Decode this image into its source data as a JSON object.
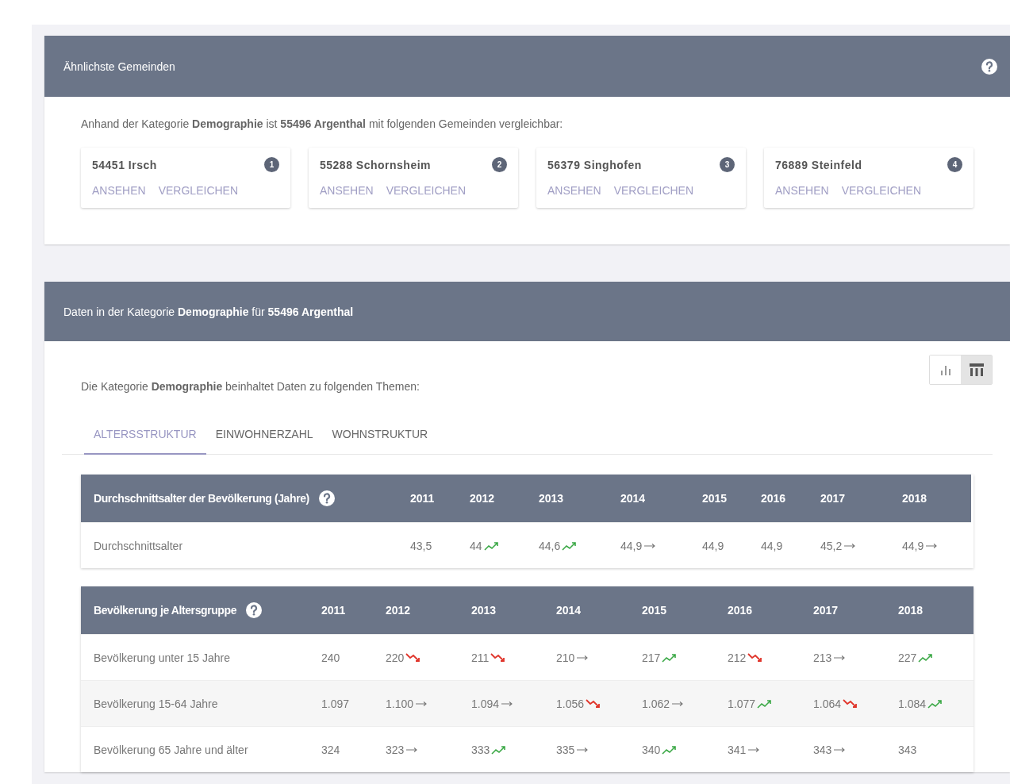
{
  "similar_panel": {
    "title": "Ähnlichste Gemeinden",
    "intro": "Anhand der Kategorie **Demographie** ist **55496 Argenthal** mit folgenden Gemeinden vergleichbar:",
    "municipalities": [
      {
        "name": "54451 Irsch",
        "rank": "1",
        "actions": [
          "ANSEHEN",
          "VERGLEICHEN"
        ]
      },
      {
        "name": "55288 Schornsheim",
        "rank": "2",
        "actions": [
          "ANSEHEN",
          "VERGLEICHEN"
        ]
      },
      {
        "name": "56379 Singhofen",
        "rank": "3",
        "actions": [
          "ANSEHEN",
          "VERGLEICHEN"
        ]
      },
      {
        "name": "76889 Steinfeld",
        "rank": "4",
        "actions": [
          "ANSEHEN",
          "VERGLEICHEN"
        ]
      }
    ]
  },
  "data_panel": {
    "title": "Daten in der Kategorie **Demographie** für **55496 Argenthal**",
    "view_toggle": [
      {
        "kind": "chart",
        "selected": false
      },
      {
        "kind": "table",
        "selected": true
      }
    ],
    "intro": "Die Kategorie **Demographie** beinhaltet Daten zu folgenden Themen:",
    "tabs": [
      {
        "label": "ALTERSSTRUKTUR",
        "selected": true
      },
      {
        "label": "EINWOHNERZAHL",
        "selected": false
      },
      {
        "label": "WOHNSTRUKTUR",
        "selected": false
      }
    ],
    "tables": [
      {
        "title": "Durchschnittsalter der Bevölkerung (Jahre)",
        "years": [
          "2011",
          "2012",
          "2013",
          "2014",
          "2015",
          "2016",
          "2017",
          "2018"
        ],
        "rows": [
          {
            "label": "Durchschnittsalter",
            "cells": [
              {
                "value": "43,5",
                "kind": "plain"
              },
              {
                "value": "44",
                "kind": "up"
              },
              {
                "value": "44,6",
                "kind": "up"
              },
              {
                "value": "44,9",
                "kind": "flat"
              },
              {
                "value": "44,9",
                "kind": "plain"
              },
              {
                "value": "44,9",
                "kind": "plain"
              },
              {
                "value": "45,2",
                "kind": "flat"
              },
              {
                "value": "44,9",
                "kind": "flat"
              }
            ]
          }
        ]
      },
      {
        "title": "Bevölkerung je Altersgruppe",
        "years": [
          "2011",
          "2012",
          "2013",
          "2014",
          "2015",
          "2016",
          "2017",
          "2018"
        ],
        "rows": [
          {
            "label": "Bevölkerung unter 15 Jahre",
            "cells": [
              {
                "value": "240",
                "kind": "plain"
              },
              {
                "value": "220",
                "kind": "down"
              },
              {
                "value": "211",
                "kind": "down"
              },
              {
                "value": "210",
                "kind": "flat"
              },
              {
                "value": "217",
                "kind": "up"
              },
              {
                "value": "212",
                "kind": "down"
              },
              {
                "value": "213",
                "kind": "flat"
              },
              {
                "value": "227",
                "kind": "up"
              }
            ]
          },
          {
            "label": "Bevölkerung 15-64 Jahre",
            "cells": [
              {
                "value": "1.097",
                "kind": "plain"
              },
              {
                "value": "1.100",
                "kind": "flat"
              },
              {
                "value": "1.094",
                "kind": "flat"
              },
              {
                "value": "1.056",
                "kind": "down"
              },
              {
                "value": "1.062",
                "kind": "flat"
              },
              {
                "value": "1.077",
                "kind": "up"
              },
              {
                "value": "1.064",
                "kind": "down"
              },
              {
                "value": "1.084",
                "kind": "up"
              }
            ]
          },
          {
            "label": "Bevölkerung 65 Jahre und älter",
            "cells": [
              {
                "value": "324",
                "kind": "plain"
              },
              {
                "value": "323",
                "kind": "flat"
              },
              {
                "value": "333",
                "kind": "up"
              },
              {
                "value": "335",
                "kind": "flat"
              },
              {
                "value": "340",
                "kind": "up"
              },
              {
                "value": "341",
                "kind": "flat"
              },
              {
                "value": "343",
                "kind": "flat"
              },
              {
                "value": "343",
                "kind": "plain"
              }
            ]
          }
        ]
      }
    ]
  }
}
